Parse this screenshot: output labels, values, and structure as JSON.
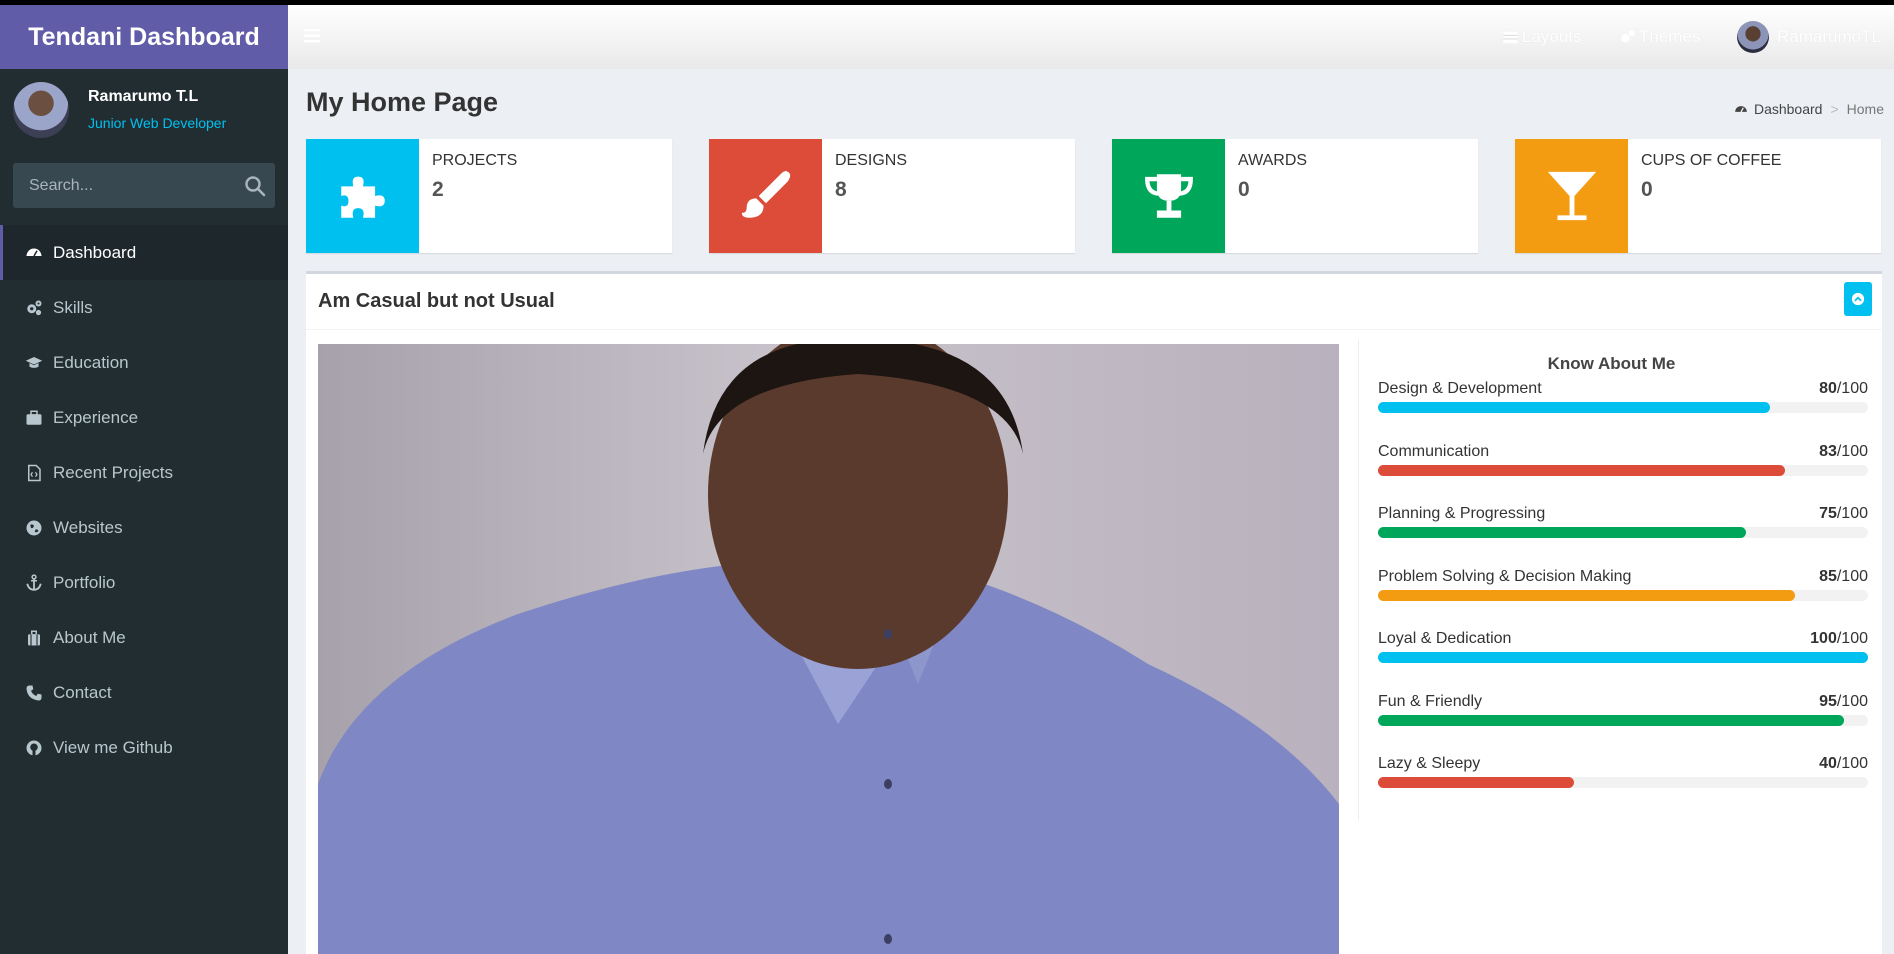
{
  "app": {
    "title": "Tendani Dashboard"
  },
  "user": {
    "name": "Ramarumo T.L",
    "role": "Junior Web Developer"
  },
  "search": {
    "placeholder": "Search..."
  },
  "sidebar": {
    "items": [
      {
        "label": "Dashboard",
        "icon": "dashboard-icon",
        "active": true
      },
      {
        "label": "Skills",
        "icon": "cogs-icon"
      },
      {
        "label": "Education",
        "icon": "graduation-cap-icon"
      },
      {
        "label": "Experience",
        "icon": "briefcase-icon"
      },
      {
        "label": "Recent Projects",
        "icon": "file-code-icon"
      },
      {
        "label": "Websites",
        "icon": "globe-icon"
      },
      {
        "label": "Portfolio",
        "icon": "anchor-icon"
      },
      {
        "label": "About Me",
        "icon": "suitcase-icon"
      },
      {
        "label": "Contact",
        "icon": "phone-icon"
      },
      {
        "label": "View me Github",
        "icon": "github-icon"
      }
    ]
  },
  "topbar": {
    "layouts_label": "Layouts",
    "themes_label": "Themes",
    "user_label": "RamarumoTL"
  },
  "page": {
    "title": "My Home Page"
  },
  "breadcrumb": {
    "root": "Dashboard",
    "separator": ">",
    "current": "Home"
  },
  "info_boxes": [
    {
      "label": "PROJECTS",
      "value": "2",
      "color": "#00c0ef",
      "icon": "puzzle-icon"
    },
    {
      "label": "DESIGNS",
      "value": "8",
      "color": "#dd4b39",
      "icon": "paint-brush-icon"
    },
    {
      "label": "AWARDS",
      "value": "0",
      "color": "#00a65a",
      "icon": "trophy-icon"
    },
    {
      "label": "CUPS OF COFFEE",
      "value": "0",
      "color": "#f39c12",
      "icon": "glass-icon"
    }
  ],
  "panel": {
    "title": "Am Casual but not Usual"
  },
  "skills": {
    "title": "Know About Me",
    "items": [
      {
        "name": "Design & Development",
        "score": "80",
        "max": "/100",
        "color": "#00c0ef"
      },
      {
        "name": "Communication",
        "score": "83",
        "max": "/100",
        "color": "#dd4b39"
      },
      {
        "name": "Planning & Progressing",
        "score": "75",
        "max": "/100",
        "color": "#00a65a"
      },
      {
        "name": "Problem Solving & Decision Making",
        "score": "85",
        "max": "/100",
        "color": "#f39c12"
      },
      {
        "name": "Loyal & Dedication",
        "score": "100",
        "max": "/100",
        "color": "#00c0ef"
      },
      {
        "name": "Fun & Friendly",
        "score": "95",
        "max": "/100",
        "color": "#00a65a"
      },
      {
        "name": "Lazy & Sleepy",
        "score": "40",
        "max": "/100",
        "color": "#dd4b39"
      }
    ]
  },
  "colors": {
    "sidebar_bg": "#222d32",
    "logo_bg": "#605ca8",
    "accent": "#00c0ef"
  }
}
